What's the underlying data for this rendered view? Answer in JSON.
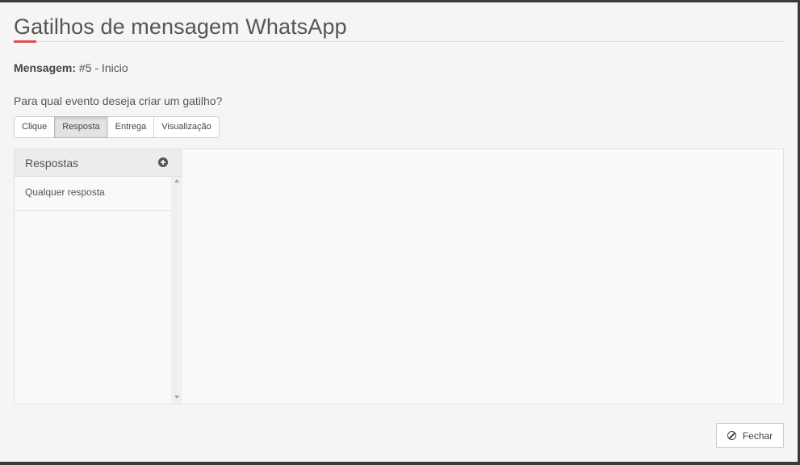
{
  "dialog": {
    "title": "Gatilhos de mensagem WhatsApp",
    "accent_color": "#d9534f"
  },
  "message": {
    "label": "Mensagem:",
    "value": "#5 - Inicio"
  },
  "question": "Para qual evento deseja criar um gatilho?",
  "event_tabs": [
    {
      "label": "Clique",
      "active": false
    },
    {
      "label": "Resposta",
      "active": true
    },
    {
      "label": "Entrega",
      "active": false
    },
    {
      "label": "Visualização",
      "active": false
    }
  ],
  "responses": {
    "header": "Respostas",
    "add_icon": "plus-circle-icon",
    "items": [
      "Qualquer resposta"
    ]
  },
  "footer": {
    "close_label": "Fechar",
    "close_icon": "ban-icon"
  }
}
